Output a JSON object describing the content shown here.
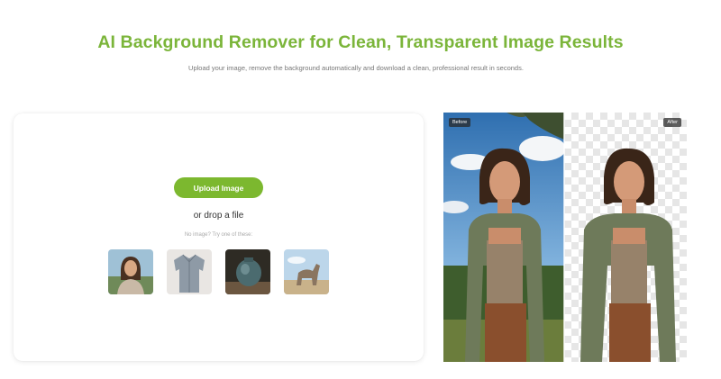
{
  "hero": {
    "title": "AI Background Remover for Clean, Transparent Image Results",
    "subtitle": "Upload your image, remove the background automatically and download a clean, professional result in seconds."
  },
  "uploader": {
    "upload_button": "Upload Image",
    "drop_text": "or drop a file",
    "hint": "No image? Try one of these:",
    "samples": [
      {
        "name": "woman-portrait"
      },
      {
        "name": "shirt"
      },
      {
        "name": "vase"
      },
      {
        "name": "dog"
      }
    ]
  },
  "comparison": {
    "before_label": "Before",
    "after_label": "After"
  },
  "colors": {
    "accent": "#7bb53a",
    "button": "#7cb82f"
  }
}
